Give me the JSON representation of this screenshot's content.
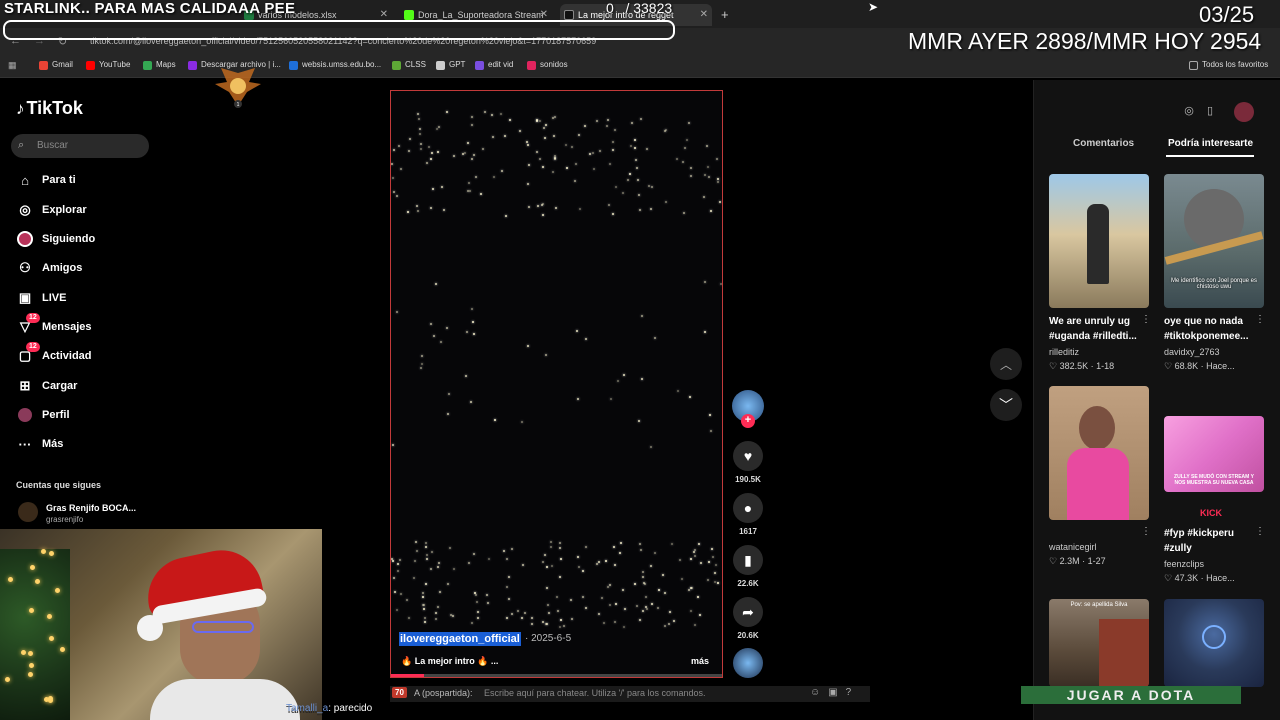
{
  "overlays": {
    "top_banner": "STARLINK.. PARA MAS CALIDAAA PEE",
    "counter": "0   / 33823",
    "date": "03/25",
    "mmr": "MMR AYER 2898/MMR HOY 2954"
  },
  "browser": {
    "tabs": [
      {
        "label": "varios modelos.xlsx",
        "color": "#1d7a3e"
      },
      {
        "label": "Dora_La_Suporteadora Stream",
        "color": "#53fc18"
      },
      {
        "label": "La mejor intro de regget",
        "color": "#111111"
      }
    ],
    "new_tab": "+",
    "url": "tiktok.com/@ilovereggaeton_official/video/7512560520558021142?q=concierto%20de%20regeton%20viejo&t=1770187570659",
    "bookmarks": [
      {
        "label": "Gmail",
        "color": "#ea4335"
      },
      {
        "label": "YouTube",
        "color": "#ff0000"
      },
      {
        "label": "Maps",
        "color": "#34a853"
      },
      {
        "label": "Descargar archivo | i...",
        "color": "#8a2be2"
      },
      {
        "label": "websis.umss.edu.bo...",
        "color": "#1e6fd9"
      },
      {
        "label": "CLSS",
        "color": "#5ea836"
      },
      {
        "label": "GPT",
        "color": "#cccccc"
      },
      {
        "label": "edit vid",
        "color": "#7a4ee0"
      },
      {
        "label": "sonidos",
        "color": "#e0245e"
      }
    ],
    "all_favorites": "Todos los favoritos"
  },
  "sidebar": {
    "logo": "TikTok",
    "search_placeholder": "Buscar",
    "items": [
      {
        "label": "Para ti",
        "icon": "home-icon"
      },
      {
        "label": "Explorar",
        "icon": "compass-icon"
      },
      {
        "label": "Siguiendo",
        "icon": "avatar-icon"
      },
      {
        "label": "Amigos",
        "icon": "friends-icon"
      },
      {
        "label": "LIVE",
        "icon": "live-icon"
      },
      {
        "label": "Mensajes",
        "icon": "messages-icon",
        "badge": "12"
      },
      {
        "label": "Actividad",
        "icon": "activity-icon",
        "badge": "12"
      },
      {
        "label": "Cargar",
        "icon": "upload-icon"
      },
      {
        "label": "Perfil",
        "icon": "profile-icon"
      },
      {
        "label": "Más",
        "icon": "more-icon"
      }
    ],
    "following_header": "Cuentas que sigues",
    "following": {
      "name": "Gras Renjifo BOCA...",
      "handle": "grasrenjifo"
    }
  },
  "video": {
    "username": "ilovereggaeton_official",
    "date": "· 2025-6-5",
    "caption": "🔥 La mejor intro 🔥 ...",
    "more": "más",
    "progress": 0.1,
    "likes": "190.5K",
    "comments": "1617",
    "saves": "22.6K",
    "shares": "20.6K"
  },
  "right_panel": {
    "tab_comments": "Comentarios",
    "tab_interesting": "Podría interesarte",
    "cards": [
      {
        "title": "We are unruly ug #uganda #rilledti...",
        "user": "rilleditiz",
        "stats": "♡ 382.5K · 1-18",
        "img_text": "",
        "bg1": "#d9c7a0",
        "bg2": "#8a7a5c"
      },
      {
        "title": "oye que no nada #tiktokponemee...",
        "user": "davidxy_2763",
        "stats": "♡ 68.8K · Hace...",
        "img_text": "Me identifico con Joel porque es chistoso uwu",
        "bg1": "#7a8a90",
        "bg2": "#3a4a50"
      },
      {
        "title": "",
        "user": "watanicegirl",
        "stats": "♡ 2.3M · 1-27",
        "img_text": "",
        "bg1": "#b08060",
        "bg2": "#e84aa0"
      },
      {
        "title": "#fyp #kickperu #zully",
        "user": "feenzclips",
        "stats": "♡ 47.3K · Hace...",
        "img_text": "ZULLY SE MUDÓ CON STREAM Y NOS MUESTRA SU NUEVA CASA",
        "bg1": "#f08ad0",
        "bg2": "#d04aa0"
      },
      {
        "title": "",
        "user": "",
        "stats": "",
        "img_text": "Pov: se apellida Silva",
        "bg1": "#6a5a4a",
        "bg2": "#3a2e24"
      },
      {
        "title": "",
        "user": "",
        "stats": "",
        "img_text": "",
        "bg1": "#3a4a6a",
        "bg2": "#1a2440"
      }
    ]
  },
  "chat": {
    "badge": "70",
    "user": "A (pospartida):",
    "placeholder": "Escribe aquí para chatear. Utiliza '/' para los comandos.",
    "line_user": "Tamalli_a",
    "line_text": ": parecido"
  },
  "webcam_label": "Tamalli_a",
  "dota_button": "JUGAR A DOTA",
  "emblem_number": "1"
}
